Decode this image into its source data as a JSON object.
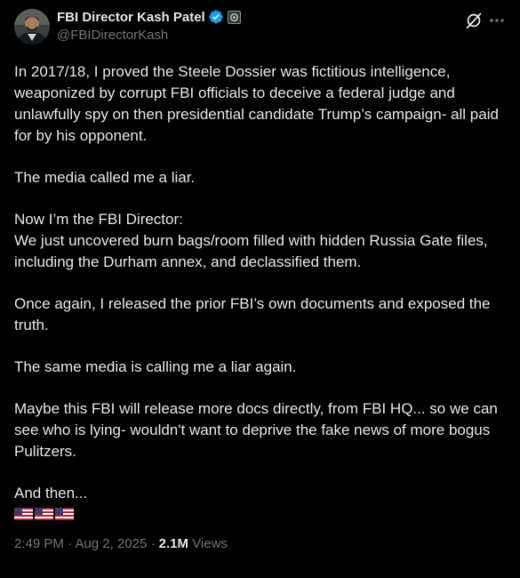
{
  "author": {
    "display_name": "FBI Director Kash Patel",
    "handle": "@FBIDirectorKash",
    "avatar_icon": "profile-photo",
    "verified_icon": "verified-badge-icon",
    "affiliation_icon": "government-affiliation-icon"
  },
  "actions": {
    "grok_icon": "grok-icon",
    "more_icon": "more-options-icon"
  },
  "tweet": {
    "paragraphs": [
      "In 2017/18, I proved the Steele Dossier was fictitious intelligence, weaponized by corrupt FBI officials to deceive a federal judge and unlawfully spy on then presidential candidate Trump’s campaign- all paid for by his opponent.",
      "The media called me a liar.",
      "Now I’m the FBI Director:\nWe just uncovered burn bags/room filled with hidden Russia Gate files, including the Durham annex, and declassified them.",
      "Once again, I released the prior FBI’s own documents and exposed the truth.",
      "The same media is calling me a liar again.",
      "Maybe this FBI will release more docs directly, from FBI HQ... so we can see who is lying- wouldn't want to deprive the fake news of more bogus Pulitzers.",
      "And then..."
    ],
    "emoji": [
      "us-flag",
      "us-flag",
      "us-flag"
    ]
  },
  "meta": {
    "time": "2:49 PM",
    "separator": " · ",
    "date": "Aug 2, 2025",
    "views_count": "2.1M",
    "views_label": " Views"
  },
  "colors": {
    "background": "#000000",
    "text_primary": "#e7e9ea",
    "text_secondary": "#71767b",
    "verified_blue": "#1d9bf0"
  }
}
